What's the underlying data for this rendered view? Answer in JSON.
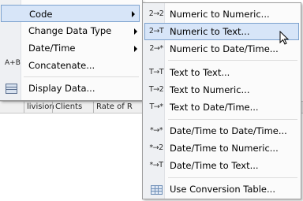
{
  "background": {
    "header_cells": [
      "livision",
      "Clients",
      "Rate of R"
    ]
  },
  "parent_menu": {
    "items": [
      {
        "label": "Code",
        "icon": "none",
        "has_submenu": true,
        "active": true
      },
      {
        "label": "Change Data Type",
        "icon": "none",
        "has_submenu": true
      },
      {
        "label": "Date/Time",
        "icon": "none",
        "has_submenu": true
      },
      {
        "label": "Concatenate...",
        "icon": "concatenate-icon",
        "icon_text": "A+B",
        "has_submenu": false
      },
      {
        "label": "Display Data...",
        "icon": "display-data-icon",
        "has_submenu": false
      }
    ]
  },
  "submenu": {
    "items": [
      {
        "label": "Numeric to Numeric...",
        "icon_text": "2→2"
      },
      {
        "label": "Numeric to Text...",
        "icon_text": "2→T",
        "active": true
      },
      {
        "label": "Numeric to Date/Time...",
        "icon_text": "2→*"
      },
      {
        "label": "Text to Text...",
        "icon_text": "T→T"
      },
      {
        "label": "Text to Numeric...",
        "icon_text": "T→2"
      },
      {
        "label": "Text to Date/Time...",
        "icon_text": "T→*"
      },
      {
        "label": "Date/Time to Date/Time...",
        "icon_text": "*→*"
      },
      {
        "label": "Date/Time to Numeric...",
        "icon_text": "*→2"
      },
      {
        "label": "Date/Time to Text...",
        "icon_text": "*→T"
      },
      {
        "label": "Use Conversion Table...",
        "icon": "conversion-table-icon"
      }
    ]
  },
  "colors": {
    "menu_bg": "#fbfbfb",
    "highlight_bg": "#d7e5f8",
    "highlight_border": "#7da2ce",
    "gutter": "#eef0f3"
  }
}
